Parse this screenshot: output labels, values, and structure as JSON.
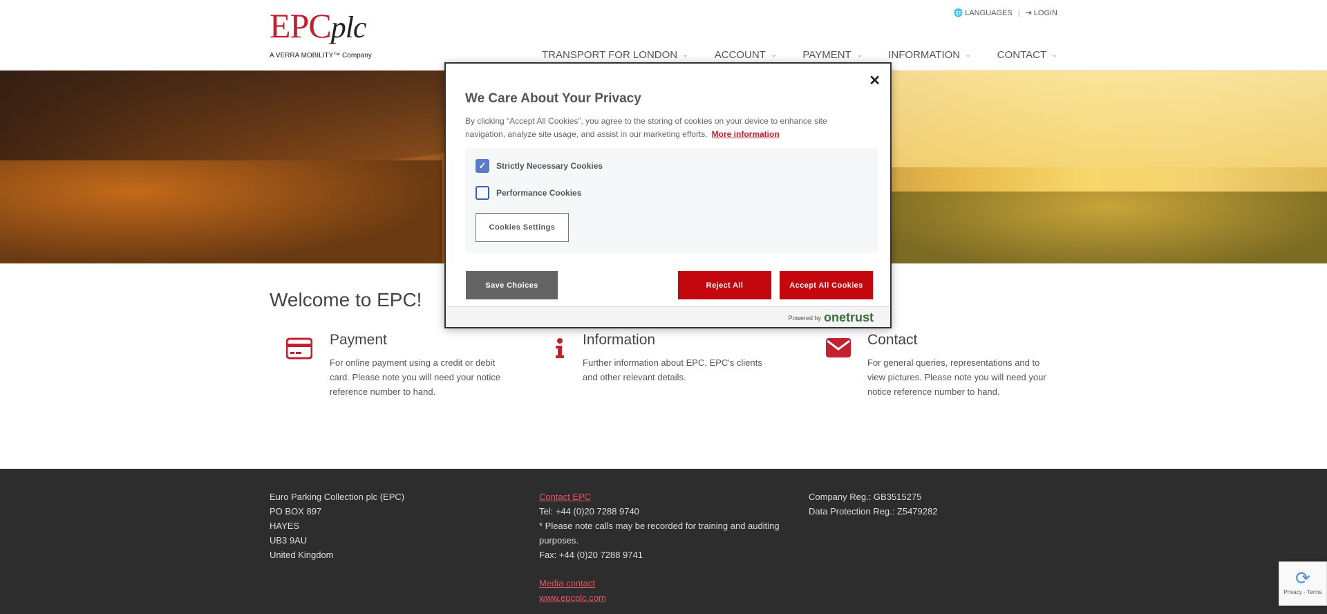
{
  "header": {
    "logo_main": "EPC",
    "logo_plc": "plc",
    "logo_sub": "A VERRA MOBILITY™ Company",
    "languages": "LANGUAGES",
    "login": "LOGIN",
    "nav": [
      {
        "label": "TRANSPORT FOR LONDON"
      },
      {
        "label": "ACCOUNT"
      },
      {
        "label": "PAYMENT"
      },
      {
        "label": "INFORMATION"
      },
      {
        "label": "CONTACT"
      }
    ]
  },
  "main": {
    "welcome": "Welcome to EPC!",
    "features": [
      {
        "icon": "credit-card-icon",
        "title": "Payment",
        "text": "For online payment using a credit or debit card. Please note you will need your notice reference number to hand."
      },
      {
        "icon": "info-icon",
        "title": "Information",
        "text": "Further information about EPC, EPC's clients and other relevant details."
      },
      {
        "icon": "envelope-icon",
        "title": "Contact",
        "text": "For general queries, representations and to view pictures. Please note you will need your notice reference number to hand."
      }
    ]
  },
  "footer": {
    "address": [
      "Euro Parking Collection plc (EPC)",
      "PO BOX 897",
      "HAYES",
      "UB3 9AU",
      "United Kingdom"
    ],
    "contact_link": "Contact EPC",
    "tel": "Tel: +44 (0)20 7288 9740",
    "note": "* Please note calls may be recorded for training and auditing purposes.",
    "fax": "Fax: +44 (0)20 7288 9741",
    "media_link": "Media contact",
    "website_link": "www.epcplc.com",
    "company_reg": "Company Reg.: GB3515275",
    "data_reg": "Data Protection Reg.: Z5479282"
  },
  "modal": {
    "title": "We Care About Your Privacy",
    "desc": "By clicking “Accept All Cookies”, you agree to the storing of cookies on your device to enhance site navigation, analyze site usage, and assist in our marketing efforts.",
    "more_info": "More information",
    "prefs": [
      {
        "label": "Strictly Necessary Cookies",
        "checked": true
      },
      {
        "label": "Performance Cookies",
        "checked": false
      }
    ],
    "settings_btn": "Cookies Settings",
    "save_btn": "Save Choices",
    "reject_btn": "Reject All",
    "accept_btn": "Accept All Cookies",
    "powered_by": "Powered by",
    "onetrust": "onetrust"
  },
  "recaptcha": {
    "text": "Privacy - Terms"
  },
  "colors": {
    "brand_red": "#c4202f",
    "button_red": "#c4060e",
    "footer_bg": "#2d2d2d"
  }
}
